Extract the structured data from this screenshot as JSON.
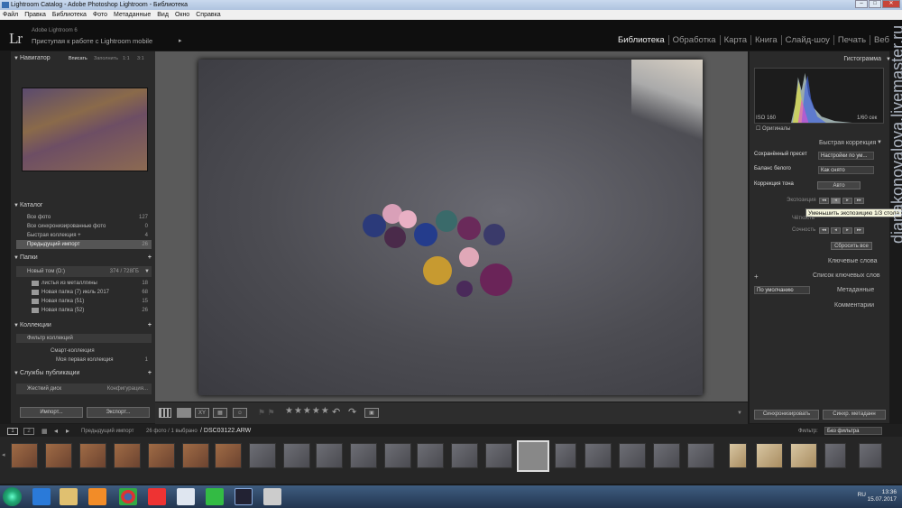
{
  "window": {
    "title": "Lightroom Catalog - Adobe Photoshop Lightroom - Библиотека"
  },
  "menu": [
    "Файл",
    "Правка",
    "Библиотека",
    "Фото",
    "Метаданные",
    "Вид",
    "Окно",
    "Справка"
  ],
  "identity": {
    "logo": "Lr",
    "version": "Adobe Lightroom 6",
    "mobile": "Приступая к работе с Lightroom mobile",
    "arrow": "▸"
  },
  "modules": [
    "Библиотека",
    "Обработка",
    "Карта",
    "Книга",
    "Слайд-шоу",
    "Печать",
    "Веб"
  ],
  "navigator": {
    "title": "Навигатор",
    "fit": "Вписать",
    "fill": "Заполнить",
    "one": "1:1",
    "three": "3:1"
  },
  "catalog": {
    "title": "Каталог",
    "items": [
      {
        "label": "Все фото",
        "count": "127"
      },
      {
        "label": "Все синхронизированные фото",
        "count": "0"
      },
      {
        "label": "Быстрая коллекция  +",
        "count": "4"
      },
      {
        "label": "Предыдущий импорт",
        "count": "26"
      }
    ]
  },
  "folders": {
    "title": "Папки",
    "volume": "Новый том (D:)",
    "volume_info": "374 / 728ГБ",
    "items": [
      {
        "label": "листья из металлгины",
        "count": "18"
      },
      {
        "label": "Новая папка (7) июль 2017",
        "count": "68"
      },
      {
        "label": "Новая папка (51)",
        "count": "15"
      },
      {
        "label": "Новая папка (52)",
        "count": "26"
      }
    ]
  },
  "collections": {
    "title": "Коллекции",
    "filter": "Фильтр коллекций",
    "items": [
      {
        "label": "Смарт-коллекция",
        "count": ""
      },
      {
        "label": "Моя первая коллекция",
        "count": "1"
      }
    ]
  },
  "publish": {
    "title": "Службы публикации",
    "hdd": "Жесткий диск",
    "config": "Конфигурация..."
  },
  "buttons": {
    "import": "Импорт...",
    "export": "Экспорт..."
  },
  "toolbar": {
    "stars": "★★★★★"
  },
  "right": {
    "histogram": "Гистограмма",
    "iso": "ISO 160",
    "shutter": "1/60 сек",
    "originals": "Оригиналы",
    "quick": "Быстрая коррекция",
    "preset_label": "Сохранённый пресет",
    "preset_value": "Настройки по ум...",
    "wb_label": "Баланс белого",
    "wb_value": "Как снято",
    "tone_label": "Коррекция тона",
    "auto": "Авто",
    "exposure": "Экспозиция",
    "clarity": "Чёткость",
    "saturation": "Сочность",
    "reset": "Сбросить все",
    "keywords": "Ключевые слова",
    "keyword_list": "Список ключевых слов",
    "default": "По умолчанию",
    "metadata": "Метаданные",
    "comments": "Комментарии",
    "sync": "Синхронизировать",
    "sync_settings": "Синхр. метаданн"
  },
  "tooltip": "Уменьшить экспозицию 1/3 стола",
  "filmbar": {
    "source": "Предыдущий импорт",
    "info": "26 фото / 1 выбрано",
    "file": "/ DSC03122.ARW",
    "filter_label": "Фильтр:",
    "filter_value": "Без фильтра"
  },
  "taskbar": {
    "lang": "RU",
    "time": "13:36",
    "date": "15.07.2017"
  },
  "watermark": "dianakonovalova.livemaster.ru"
}
